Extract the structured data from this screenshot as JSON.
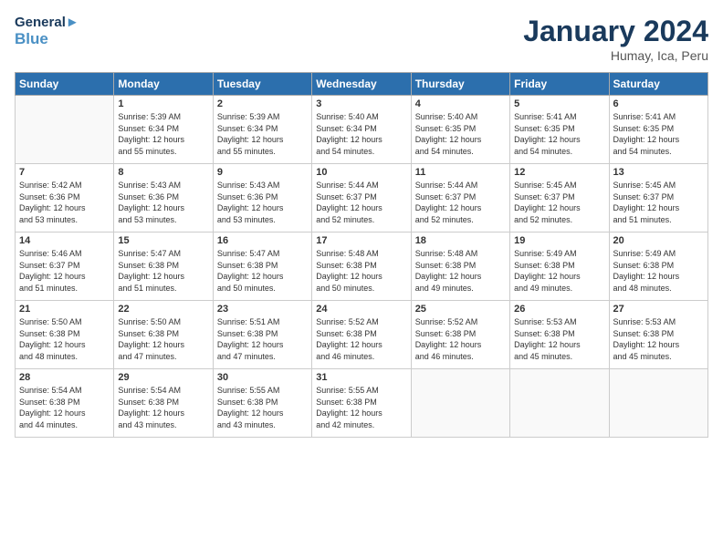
{
  "app": {
    "logo_line1": "General",
    "logo_line2": "Blue"
  },
  "calendar": {
    "title": "January 2024",
    "subtitle": "Humay, Ica, Peru"
  },
  "headers": [
    "Sunday",
    "Monday",
    "Tuesday",
    "Wednesday",
    "Thursday",
    "Friday",
    "Saturday"
  ],
  "weeks": [
    [
      {
        "day": "",
        "info": ""
      },
      {
        "day": "1",
        "info": "Sunrise: 5:39 AM\nSunset: 6:34 PM\nDaylight: 12 hours\nand 55 minutes."
      },
      {
        "day": "2",
        "info": "Sunrise: 5:39 AM\nSunset: 6:34 PM\nDaylight: 12 hours\nand 55 minutes."
      },
      {
        "day": "3",
        "info": "Sunrise: 5:40 AM\nSunset: 6:34 PM\nDaylight: 12 hours\nand 54 minutes."
      },
      {
        "day": "4",
        "info": "Sunrise: 5:40 AM\nSunset: 6:35 PM\nDaylight: 12 hours\nand 54 minutes."
      },
      {
        "day": "5",
        "info": "Sunrise: 5:41 AM\nSunset: 6:35 PM\nDaylight: 12 hours\nand 54 minutes."
      },
      {
        "day": "6",
        "info": "Sunrise: 5:41 AM\nSunset: 6:35 PM\nDaylight: 12 hours\nand 54 minutes."
      }
    ],
    [
      {
        "day": "7",
        "info": "Sunrise: 5:42 AM\nSunset: 6:36 PM\nDaylight: 12 hours\nand 53 minutes."
      },
      {
        "day": "8",
        "info": "Sunrise: 5:43 AM\nSunset: 6:36 PM\nDaylight: 12 hours\nand 53 minutes."
      },
      {
        "day": "9",
        "info": "Sunrise: 5:43 AM\nSunset: 6:36 PM\nDaylight: 12 hours\nand 53 minutes."
      },
      {
        "day": "10",
        "info": "Sunrise: 5:44 AM\nSunset: 6:37 PM\nDaylight: 12 hours\nand 52 minutes."
      },
      {
        "day": "11",
        "info": "Sunrise: 5:44 AM\nSunset: 6:37 PM\nDaylight: 12 hours\nand 52 minutes."
      },
      {
        "day": "12",
        "info": "Sunrise: 5:45 AM\nSunset: 6:37 PM\nDaylight: 12 hours\nand 52 minutes."
      },
      {
        "day": "13",
        "info": "Sunrise: 5:45 AM\nSunset: 6:37 PM\nDaylight: 12 hours\nand 51 minutes."
      }
    ],
    [
      {
        "day": "14",
        "info": "Sunrise: 5:46 AM\nSunset: 6:37 PM\nDaylight: 12 hours\nand 51 minutes."
      },
      {
        "day": "15",
        "info": "Sunrise: 5:47 AM\nSunset: 6:38 PM\nDaylight: 12 hours\nand 51 minutes."
      },
      {
        "day": "16",
        "info": "Sunrise: 5:47 AM\nSunset: 6:38 PM\nDaylight: 12 hours\nand 50 minutes."
      },
      {
        "day": "17",
        "info": "Sunrise: 5:48 AM\nSunset: 6:38 PM\nDaylight: 12 hours\nand 50 minutes."
      },
      {
        "day": "18",
        "info": "Sunrise: 5:48 AM\nSunset: 6:38 PM\nDaylight: 12 hours\nand 49 minutes."
      },
      {
        "day": "19",
        "info": "Sunrise: 5:49 AM\nSunset: 6:38 PM\nDaylight: 12 hours\nand 49 minutes."
      },
      {
        "day": "20",
        "info": "Sunrise: 5:49 AM\nSunset: 6:38 PM\nDaylight: 12 hours\nand 48 minutes."
      }
    ],
    [
      {
        "day": "21",
        "info": "Sunrise: 5:50 AM\nSunset: 6:38 PM\nDaylight: 12 hours\nand 48 minutes."
      },
      {
        "day": "22",
        "info": "Sunrise: 5:50 AM\nSunset: 6:38 PM\nDaylight: 12 hours\nand 47 minutes."
      },
      {
        "day": "23",
        "info": "Sunrise: 5:51 AM\nSunset: 6:38 PM\nDaylight: 12 hours\nand 47 minutes."
      },
      {
        "day": "24",
        "info": "Sunrise: 5:52 AM\nSunset: 6:38 PM\nDaylight: 12 hours\nand 46 minutes."
      },
      {
        "day": "25",
        "info": "Sunrise: 5:52 AM\nSunset: 6:38 PM\nDaylight: 12 hours\nand 46 minutes."
      },
      {
        "day": "26",
        "info": "Sunrise: 5:53 AM\nSunset: 6:38 PM\nDaylight: 12 hours\nand 45 minutes."
      },
      {
        "day": "27",
        "info": "Sunrise: 5:53 AM\nSunset: 6:38 PM\nDaylight: 12 hours\nand 45 minutes."
      }
    ],
    [
      {
        "day": "28",
        "info": "Sunrise: 5:54 AM\nSunset: 6:38 PM\nDaylight: 12 hours\nand 44 minutes."
      },
      {
        "day": "29",
        "info": "Sunrise: 5:54 AM\nSunset: 6:38 PM\nDaylight: 12 hours\nand 43 minutes."
      },
      {
        "day": "30",
        "info": "Sunrise: 5:55 AM\nSunset: 6:38 PM\nDaylight: 12 hours\nand 43 minutes."
      },
      {
        "day": "31",
        "info": "Sunrise: 5:55 AM\nSunset: 6:38 PM\nDaylight: 12 hours\nand 42 minutes."
      },
      {
        "day": "",
        "info": ""
      },
      {
        "day": "",
        "info": ""
      },
      {
        "day": "",
        "info": ""
      }
    ]
  ]
}
